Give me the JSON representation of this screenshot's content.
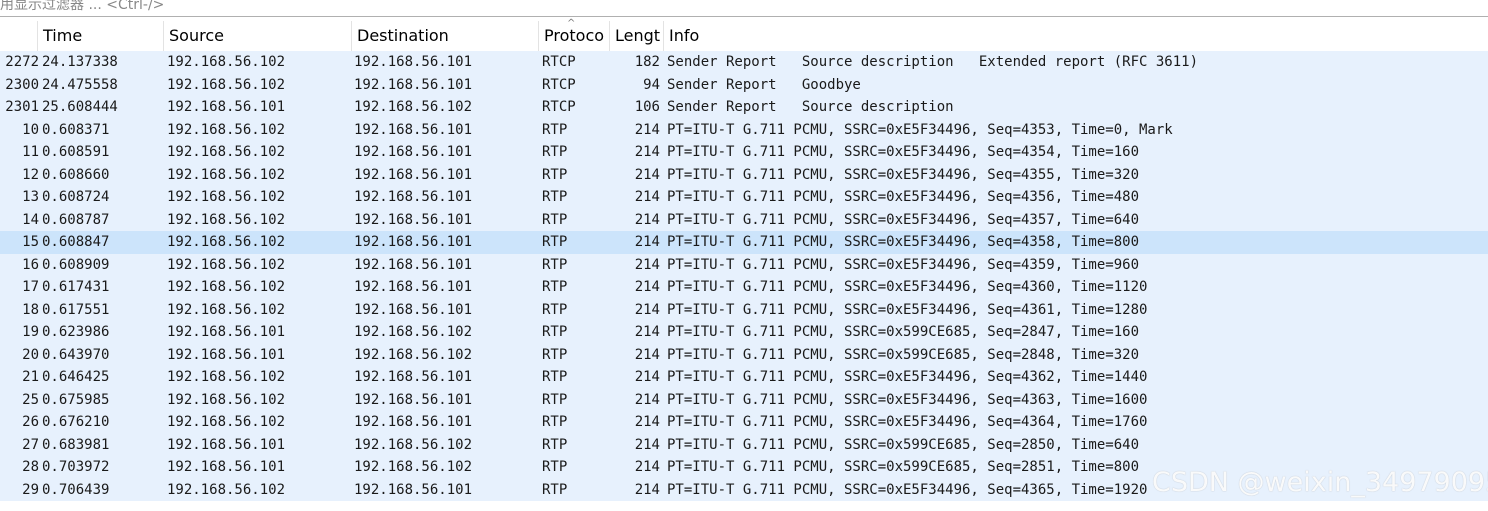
{
  "filter": {
    "placeholder": "用显示过滤器 ... <Ctrl-/>"
  },
  "columns": {
    "no": "",
    "time": "Time",
    "source": "Source",
    "destination": "Destination",
    "protocol": "Protoco",
    "length": "Lengt",
    "info": "Info"
  },
  "sort_indicator": "^",
  "selected_row_index": 8,
  "packets": [
    {
      "no": "2272",
      "time": "24.137338",
      "src": "192.168.56.102",
      "dst": "192.168.56.101",
      "proto": "RTCP",
      "len": "182",
      "info": "Sender Report   Source description   Extended report (RFC 3611)"
    },
    {
      "no": "2300",
      "time": "24.475558",
      "src": "192.168.56.102",
      "dst": "192.168.56.101",
      "proto": "RTCP",
      "len": "94",
      "info": "Sender Report   Goodbye"
    },
    {
      "no": "2301",
      "time": "25.608444",
      "src": "192.168.56.101",
      "dst": "192.168.56.102",
      "proto": "RTCP",
      "len": "106",
      "info": "Sender Report   Source description"
    },
    {
      "no": "10",
      "time": "0.608371",
      "src": "192.168.56.102",
      "dst": "192.168.56.101",
      "proto": "RTP",
      "len": "214",
      "info": "PT=ITU-T G.711 PCMU, SSRC=0xE5F34496, Seq=4353, Time=0, Mark"
    },
    {
      "no": "11",
      "time": "0.608591",
      "src": "192.168.56.102",
      "dst": "192.168.56.101",
      "proto": "RTP",
      "len": "214",
      "info": "PT=ITU-T G.711 PCMU, SSRC=0xE5F34496, Seq=4354, Time=160"
    },
    {
      "no": "12",
      "time": "0.608660",
      "src": "192.168.56.102",
      "dst": "192.168.56.101",
      "proto": "RTP",
      "len": "214",
      "info": "PT=ITU-T G.711 PCMU, SSRC=0xE5F34496, Seq=4355, Time=320"
    },
    {
      "no": "13",
      "time": "0.608724",
      "src": "192.168.56.102",
      "dst": "192.168.56.101",
      "proto": "RTP",
      "len": "214",
      "info": "PT=ITU-T G.711 PCMU, SSRC=0xE5F34496, Seq=4356, Time=480"
    },
    {
      "no": "14",
      "time": "0.608787",
      "src": "192.168.56.102",
      "dst": "192.168.56.101",
      "proto": "RTP",
      "len": "214",
      "info": "PT=ITU-T G.711 PCMU, SSRC=0xE5F34496, Seq=4357, Time=640"
    },
    {
      "no": "15",
      "time": "0.608847",
      "src": "192.168.56.102",
      "dst": "192.168.56.101",
      "proto": "RTP",
      "len": "214",
      "info": "PT=ITU-T G.711 PCMU, SSRC=0xE5F34496, Seq=4358, Time=800"
    },
    {
      "no": "16",
      "time": "0.608909",
      "src": "192.168.56.102",
      "dst": "192.168.56.101",
      "proto": "RTP",
      "len": "214",
      "info": "PT=ITU-T G.711 PCMU, SSRC=0xE5F34496, Seq=4359, Time=960"
    },
    {
      "no": "17",
      "time": "0.617431",
      "src": "192.168.56.102",
      "dst": "192.168.56.101",
      "proto": "RTP",
      "len": "214",
      "info": "PT=ITU-T G.711 PCMU, SSRC=0xE5F34496, Seq=4360, Time=1120"
    },
    {
      "no": "18",
      "time": "0.617551",
      "src": "192.168.56.102",
      "dst": "192.168.56.101",
      "proto": "RTP",
      "len": "214",
      "info": "PT=ITU-T G.711 PCMU, SSRC=0xE5F34496, Seq=4361, Time=1280"
    },
    {
      "no": "19",
      "time": "0.623986",
      "src": "192.168.56.101",
      "dst": "192.168.56.102",
      "proto": "RTP",
      "len": "214",
      "info": "PT=ITU-T G.711 PCMU, SSRC=0x599CE685, Seq=2847, Time=160"
    },
    {
      "no": "20",
      "time": "0.643970",
      "src": "192.168.56.101",
      "dst": "192.168.56.102",
      "proto": "RTP",
      "len": "214",
      "info": "PT=ITU-T G.711 PCMU, SSRC=0x599CE685, Seq=2848, Time=320"
    },
    {
      "no": "21",
      "time": "0.646425",
      "src": "192.168.56.102",
      "dst": "192.168.56.101",
      "proto": "RTP",
      "len": "214",
      "info": "PT=ITU-T G.711 PCMU, SSRC=0xE5F34496, Seq=4362, Time=1440"
    },
    {
      "no": "25",
      "time": "0.675985",
      "src": "192.168.56.102",
      "dst": "192.168.56.101",
      "proto": "RTP",
      "len": "214",
      "info": "PT=ITU-T G.711 PCMU, SSRC=0xE5F34496, Seq=4363, Time=1600"
    },
    {
      "no": "26",
      "time": "0.676210",
      "src": "192.168.56.102",
      "dst": "192.168.56.101",
      "proto": "RTP",
      "len": "214",
      "info": "PT=ITU-T G.711 PCMU, SSRC=0xE5F34496, Seq=4364, Time=1760"
    },
    {
      "no": "27",
      "time": "0.683981",
      "src": "192.168.56.101",
      "dst": "192.168.56.102",
      "proto": "RTP",
      "len": "214",
      "info": "PT=ITU-T G.711 PCMU, SSRC=0x599CE685, Seq=2850, Time=640"
    },
    {
      "no": "28",
      "time": "0.703972",
      "src": "192.168.56.101",
      "dst": "192.168.56.102",
      "proto": "RTP",
      "len": "214",
      "info": "PT=ITU-T G.711 PCMU, SSRC=0x599CE685, Seq=2851, Time=800"
    },
    {
      "no": "29",
      "time": "0.706439",
      "src": "192.168.56.102",
      "dst": "192.168.56.101",
      "proto": "RTP",
      "len": "214",
      "info": "PT=ITU-T G.711 PCMU, SSRC=0xE5F34496, Seq=4365, Time=1920"
    }
  ],
  "watermark": "CSDN @weixin_34979095",
  "colors": {
    "row_bg": "#e7f1fd",
    "selected_row_bg": "#cce4fb"
  }
}
